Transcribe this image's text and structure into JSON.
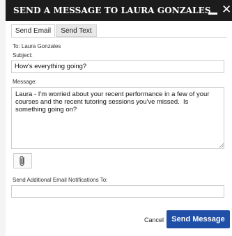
{
  "dialog": {
    "title": "SEND A MESSAGE TO LAURA GONZALES",
    "minimize_icon": "minimize-icon",
    "close_icon": "close-icon",
    "close_glyph": "✕"
  },
  "tabs": [
    {
      "label": "Send Email",
      "active": true
    },
    {
      "label": "Send Text",
      "active": false
    }
  ],
  "form": {
    "to_label": "To: Laura Gonzales",
    "subject_label": "Subject:",
    "subject_value": "How's everything going?",
    "message_label": "Message:",
    "message_value": "Laura - I'm worried about your recent performance in a few of your courses and the recent tutoring sessions you've missed.  Is something going on?",
    "attach_icon": "paperclip-icon",
    "notify_label": "Send Additional  Email Notifications To:",
    "notify_value": ""
  },
  "actions": {
    "cancel_label": "Cancel",
    "send_label": "Send Message"
  },
  "colors": {
    "titlebar": "#1c1c1c",
    "primary_button": "#1f4fa6"
  }
}
